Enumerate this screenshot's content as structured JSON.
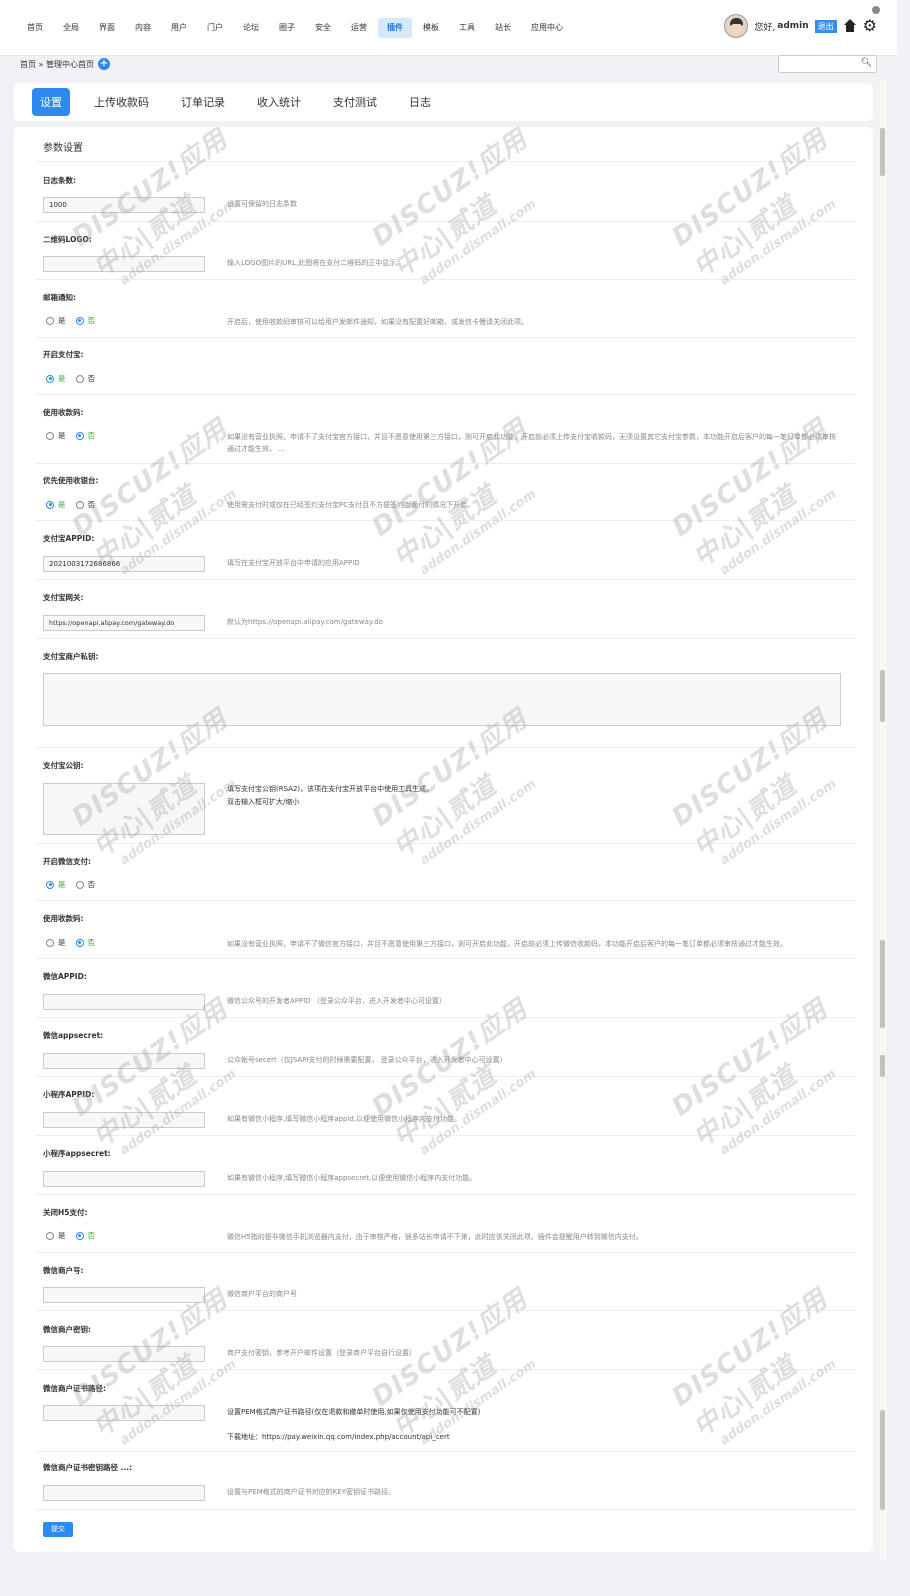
{
  "nav": {
    "items": [
      "首页",
      "全局",
      "界面",
      "内容",
      "用户",
      "门户",
      "论坛",
      "圈子",
      "安全",
      "运营",
      "插件",
      "模板",
      "工具",
      "站长",
      "应用中心"
    ],
    "active_index": 10
  },
  "user": {
    "greeting": "您好,",
    "name": "admin",
    "logout": "退出"
  },
  "breadcrumb": {
    "text": "首页 » 管理中心首页"
  },
  "search": {
    "placeholder": ""
  },
  "tabs": {
    "items": [
      "设置",
      "上传收款码",
      "订单记录",
      "收入统计",
      "支付测试",
      "日志"
    ],
    "active_index": 0
  },
  "panel": {
    "title": "参数设置"
  },
  "fields": {
    "log_count": {
      "label": "日志条数:",
      "value": "1000",
      "tip": "设置可保留的日志条数"
    },
    "qr_logo": {
      "label": "二维码LOGO:",
      "value": "",
      "tip": "输入LOGO图片的URL,此图将在支付二维码的正中显示。"
    },
    "email_notify": {
      "label": "邮箱通知:",
      "yes": "是",
      "no": "否",
      "selected": "否",
      "tip": "开启后，使用收款码审核可以给用户发邮件通知，如果没有配置好邮箱，或发信卡慢请关闭此项。"
    },
    "alipay_enable": {
      "label": "开启支付宝:",
      "yes": "是",
      "no": "否",
      "selected": "是"
    },
    "alipay_qr": {
      "label": "使用收款码:",
      "yes": "是",
      "no": "否",
      "selected": "否",
      "tip1": "如果没有营业执照，申请不了支付宝官方接口，并且不愿意使用第三方接口，则可开启此功能，开启前必须上传支付宝收款码，无须设置其它支付宝参数，本功能开启后客户的每一笔订单都必须审核",
      "tip2": "通过才能生效。 ..."
    },
    "prefer_cashier": {
      "label": "优先使用收银台:",
      "yes": "是",
      "no": "否",
      "selected": "是",
      "tip": "使用需支付时或仅在已经签约支付宝PC支付且不方便签约当面付的情况下开启。"
    },
    "alipay_appid": {
      "label": "支付宝APPID:",
      "value": "2021003172686866",
      "tip": "填写在支付宝开放平台中申请的应用APPID"
    },
    "alipay_gateway": {
      "label": "支付宝网关:",
      "value": "https://openapi.alipay.com/gateway.do",
      "tip": "默认为https://openapi.alipay.com/gateway.do"
    },
    "alipay_private_key": {
      "label": "支付宝商户私钥:"
    },
    "alipay_public_key": {
      "label": "支付宝公钥:",
      "tip1": "填写支付宝公钥(RSA2)，该项在支付宝开放平台中使用工具生成。",
      "tip2": "双击输入框可扩大/缩小"
    },
    "wechat_enable": {
      "label": "开启微信支付:",
      "yes": "是",
      "no": "否",
      "selected": "是"
    },
    "wechat_qr": {
      "label": "使用收款码:",
      "yes": "是",
      "no": "否",
      "selected": "否",
      "tip": "如果没有营业执照，申请不了微信官方接口，并且不愿意使用第三方接口，则可开启此功能，开启前必须上传微信收款码，本功能开启后客户的每一笔订单都必须审核通过才能生效。"
    },
    "wechat_appid": {
      "label": "微信APPID:",
      "value": "",
      "tip": "微信公众号的开发者APPID （登录公众平台，进入开发者中心可设置）"
    },
    "wechat_appsecret": {
      "label": "微信appsecret:",
      "value": "",
      "tip": "公众帐号secert（仅JSAPI支付的时候需要配置， 登录公众平台，进入开发者中心可设置）"
    },
    "mini_appid": {
      "label": "小程序APPID:",
      "value": "",
      "tip": "如果有微信小程序,填写微信小程序appid,以便使用微信小程序内支付功能。"
    },
    "mini_appsecret": {
      "label": "小程序appsecret:",
      "value": "",
      "tip": "如果有微信小程序,填写微信小程序appsecret,以便使用微信小程序内支付功能。"
    },
    "close_h5": {
      "label": "关闭H5支付:",
      "yes": "是",
      "no": "否",
      "selected": "否",
      "tip": "微信H5指的是非微信手机浏览器内支付，由于审核严格，很多站长申请不下来，此时应该关闭此项，插件会提醒用户转到微信内支付。"
    },
    "mch_id": {
      "label": "微信商户号:",
      "value": "",
      "tip": "微信商户平台的商户号"
    },
    "mch_key": {
      "label": "微信商户密钥:",
      "value": "",
      "tip": "商户支付密钥，参考开户邮件设置（登录商户平台自行设置）"
    },
    "cert_path": {
      "label": "微信商户证书路径:",
      "value": "",
      "tip1": "设置PEM格式商户证书路径(仅在退款和撤单时使用,如果仅使用支付功能可不配置)",
      "tip2": "下载地址：https://pay.weixin.qq.com/index.php/account/api_cert"
    },
    "cert_key_path": {
      "label": "微信商户证书密钥路径 ...:",
      "value": "",
      "tip": "设置与PEM格式的商户证书对应的KEY密钥证书路径。"
    }
  },
  "submit_label": "提交",
  "watermark": {
    "line1": "DISCUZ!应用中心|贰道",
    "line2": "addon.dismall.com"
  },
  "colors": {
    "accent": "#2c8af2",
    "active_nav_bg": "#d6e9fb"
  }
}
